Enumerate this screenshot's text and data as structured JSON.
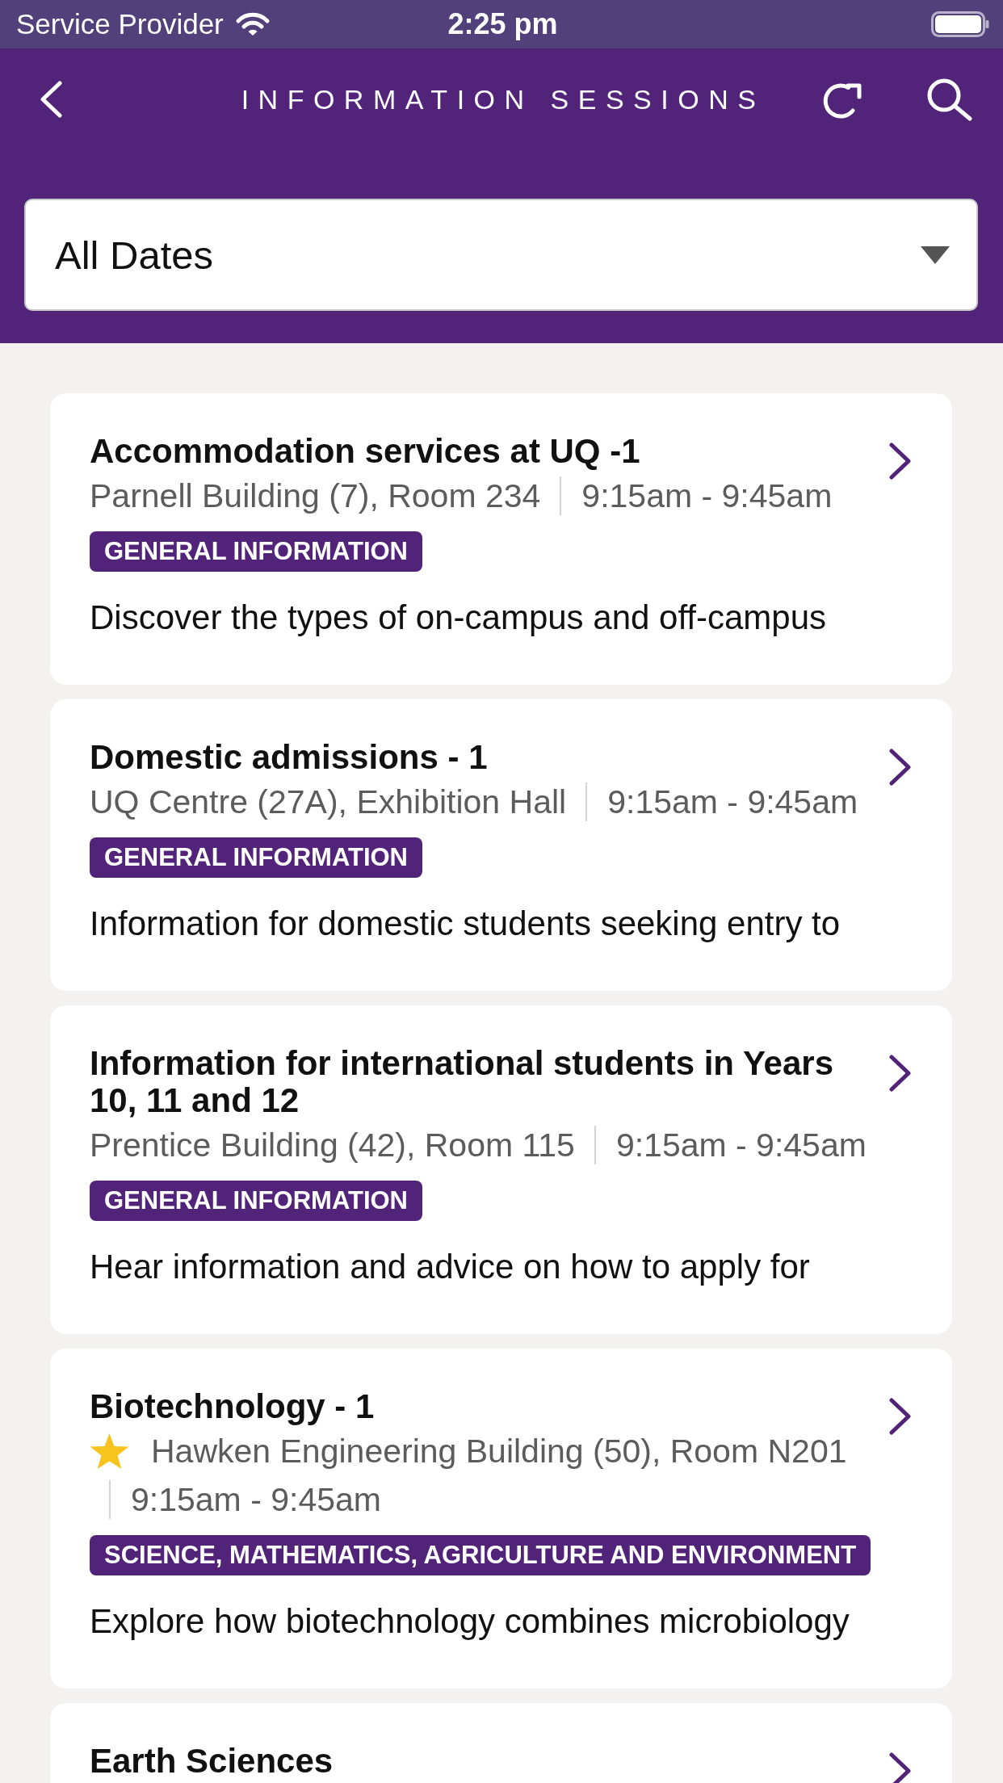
{
  "status_bar": {
    "carrier": "Service Provider",
    "time": "2:25 pm"
  },
  "header": {
    "title": "INFORMATION SESSIONS"
  },
  "date_filter": {
    "value": "All Dates"
  },
  "sessions": [
    {
      "title": "Accommodation services at UQ -1",
      "starred": false,
      "location": "Parnell Building (7), Room 234",
      "time": "9:15am - 9:45am",
      "category": "GENERAL INFORMATION",
      "description": "Discover the types of on-campus and off-campus"
    },
    {
      "title": "Domestic admissions - 1",
      "starred": false,
      "location": "UQ Centre (27A), Exhibition Hall",
      "time": "9:15am - 9:45am",
      "category": "GENERAL INFORMATION",
      "description": "Information for domestic students seeking entry to"
    },
    {
      "title": "Information for international students in Years 10, 11 and 12",
      "starred": false,
      "location": "Prentice Building (42), Room 115",
      "time": "9:15am - 9:45am",
      "category": "GENERAL INFORMATION",
      "description": "Hear information and advice on how to apply for"
    },
    {
      "title": "Biotechnology - 1",
      "starred": true,
      "location": "Hawken Engineering Building (50), Room N201",
      "time": "9:15am - 9:45am",
      "category": "SCIENCE, MATHEMATICS, AGRICULTURE AND ENVIRONMENT",
      "description": "Explore how biotechnology combines microbiology"
    },
    {
      "title": "Earth Sciences"
    }
  ]
}
